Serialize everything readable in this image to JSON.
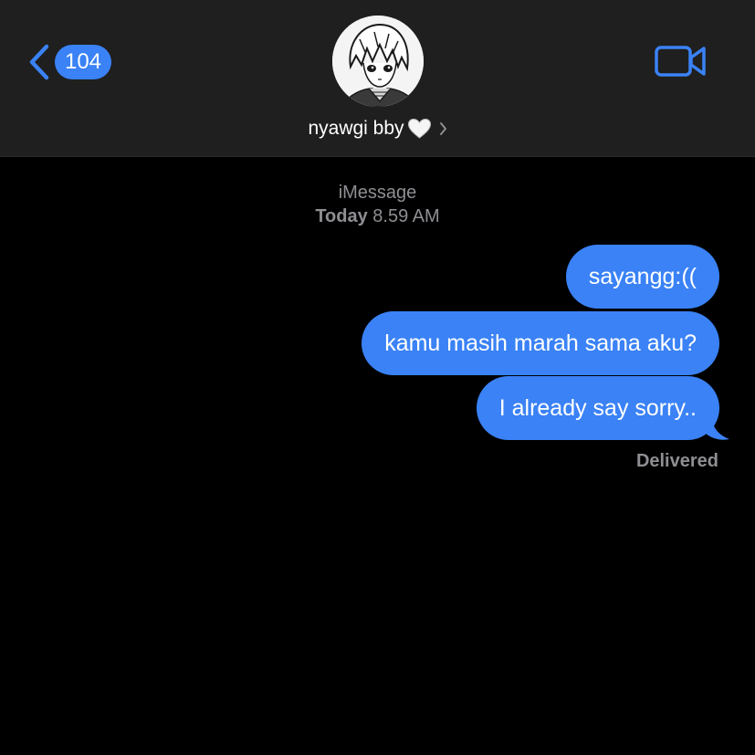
{
  "header": {
    "back_count": "104",
    "contact_name": "nyawgi bby",
    "accent": "#3a82f6",
    "background": "#1f1f1f",
    "icons": [
      "chevron-left-icon",
      "white-heart-icon",
      "chevron-right-icon",
      "video-camera-icon"
    ]
  },
  "conversation": {
    "service": "iMessage",
    "day": "Today",
    "time": "8.59 AM",
    "messages": [
      {
        "text": "sayangg:(("
      },
      {
        "text": "kamu masih marah sama aku?"
      },
      {
        "text": "I already say sorry.."
      }
    ],
    "status": "Delivered",
    "bubble_color": "#3a82f6"
  }
}
